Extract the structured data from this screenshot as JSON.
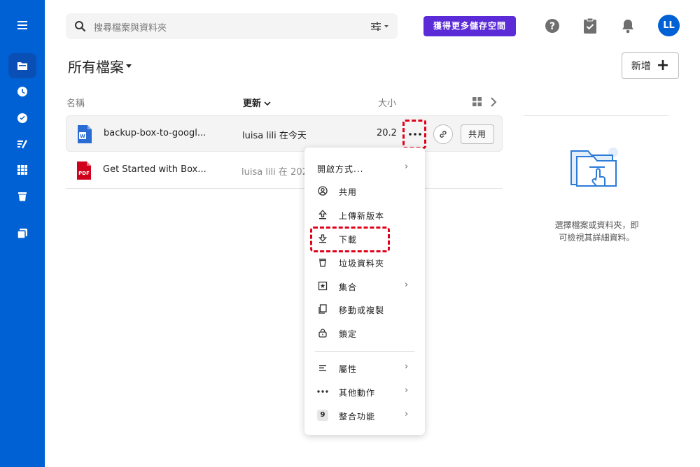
{
  "sidebar": {
    "items": [
      {
        "icon": "menu-icon"
      },
      {
        "icon": "folder-icon"
      },
      {
        "icon": "clock-icon"
      },
      {
        "icon": "check-circle-icon"
      },
      {
        "icon": "notes-icon"
      },
      {
        "icon": "apps-grid-icon"
      },
      {
        "icon": "trash-icon"
      },
      {
        "icon": "collections-icon"
      }
    ],
    "accent": "#0061d5"
  },
  "header": {
    "search_placeholder": "搜尋檔案與資料夾",
    "upgrade_label": "獲得更多儲存空間",
    "avatar_initials": "LL"
  },
  "main": {
    "title": "所有檔案",
    "new_button_label": "新增",
    "columns": {
      "name": "名稱",
      "updated": "更新",
      "size": "大小"
    },
    "files": [
      {
        "name": "backup-box-to-googl...",
        "updated": "luisa lili 在今天",
        "size": "20.2",
        "type": "word"
      },
      {
        "name": "Get Started with Box...",
        "updated": "luisa lili 在 202",
        "size": "",
        "type": "pdf"
      }
    ],
    "share_label": "共用"
  },
  "context_menu": {
    "items": [
      {
        "label": "開啟方式...",
        "icon": "",
        "has_submenu": true
      },
      {
        "label": "共用",
        "icon": "share-user-icon",
        "has_submenu": false
      },
      {
        "label": "上傳新版本",
        "icon": "upload-icon",
        "has_submenu": false
      },
      {
        "label": "下載",
        "icon": "download-icon",
        "has_submenu": false
      },
      {
        "label": "垃圾資料夾",
        "icon": "trash-icon",
        "has_submenu": false
      },
      {
        "label": "集合",
        "icon": "collection-star-icon",
        "has_submenu": true
      },
      {
        "label": "移動或複製",
        "icon": "copy-icon",
        "has_submenu": false
      },
      {
        "label": "鎖定",
        "icon": "lock-icon",
        "has_submenu": false
      },
      {
        "label": "屬性",
        "icon": "properties-icon",
        "has_submenu": true
      },
      {
        "label": "其他動作",
        "icon": "more-horizontal-icon",
        "has_submenu": true
      },
      {
        "label": "整合功能",
        "icon": "integrations-badge",
        "badge": "9",
        "has_submenu": true
      }
    ]
  },
  "details_panel": {
    "message_line1": "選擇檔案或資料夾，即",
    "message_line2": "可檢視其詳細資料。"
  },
  "colors": {
    "upgrade_button": "#5b2bd8",
    "highlight": "#e0001a",
    "word_icon": "#2b6cd4",
    "pdf_icon": "#d0021b"
  }
}
